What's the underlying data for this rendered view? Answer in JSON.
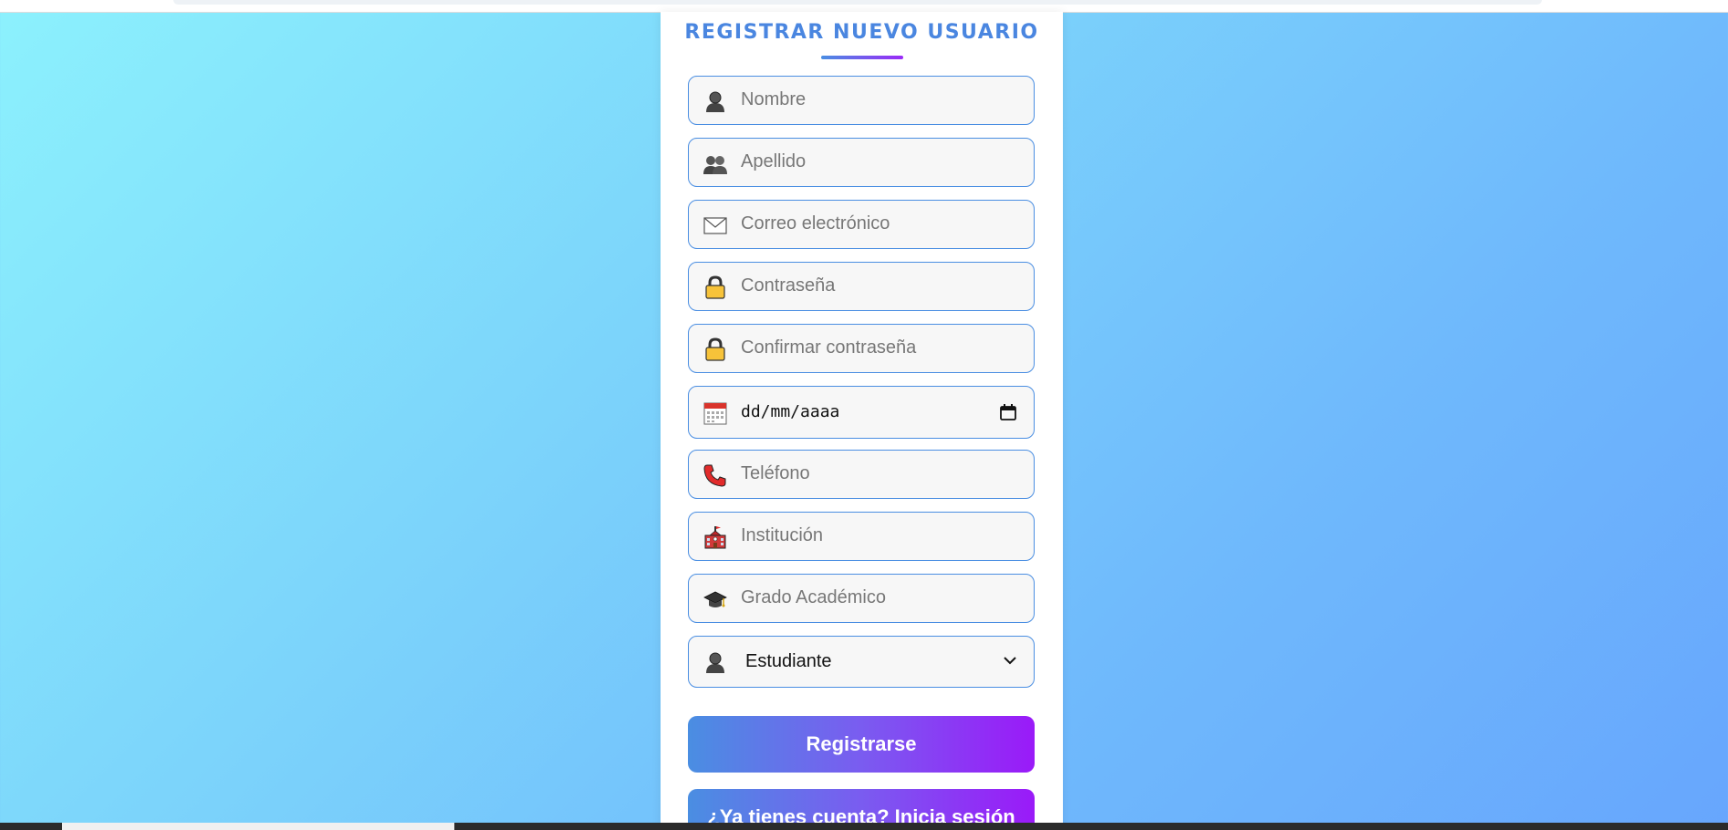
{
  "form": {
    "title": "REGISTRAR NUEVO USUARIO",
    "fields": {
      "nombre": {
        "placeholder": "Nombre",
        "icon": "person-icon"
      },
      "apellido": {
        "placeholder": "Apellido",
        "icon": "people-icon"
      },
      "correo": {
        "placeholder": "Correo electrónico",
        "icon": "envelope-icon"
      },
      "contrasena": {
        "placeholder": "Contraseña",
        "icon": "lock-icon"
      },
      "confirmar": {
        "placeholder": "Confirmar contraseña",
        "icon": "lock-icon"
      },
      "fecha": {
        "placeholder": "dd/mm/aaaa",
        "icon": "calendar-icon"
      },
      "telefono": {
        "placeholder": "Teléfono",
        "icon": "phone-icon"
      },
      "institucion": {
        "placeholder": "Institución",
        "icon": "school-icon"
      },
      "grado": {
        "placeholder": "Grado Académico",
        "icon": "graduation-cap-icon"
      },
      "rol": {
        "selected": "Estudiante",
        "icon": "person-icon"
      }
    },
    "register_label": "Registrarse",
    "login_label": "¿Ya tienes cuenta? Inicia sesión"
  },
  "colors": {
    "accent": "#4a8ee2",
    "accent_end": "#9a1af8",
    "title": "#4a86e0",
    "background_start": "#8cf1fd",
    "background_end": "#67a6fd"
  }
}
